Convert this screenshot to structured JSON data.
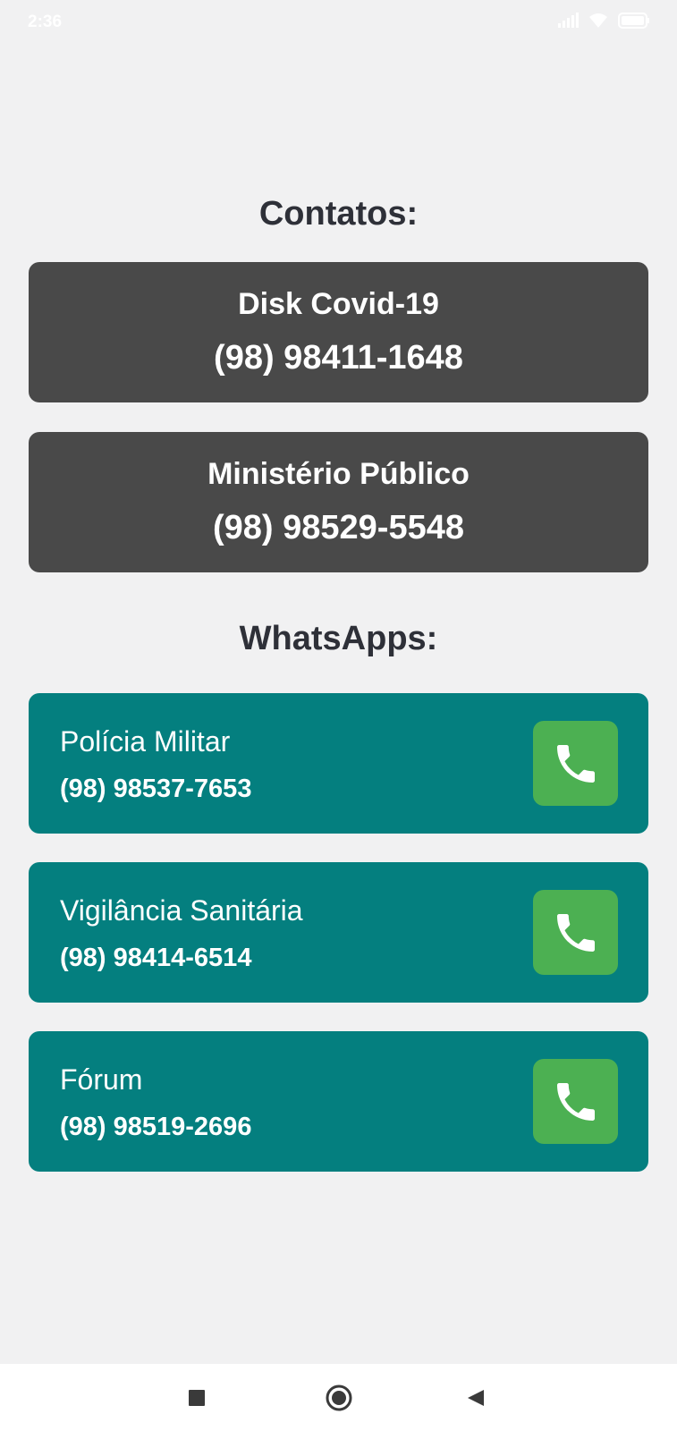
{
  "status_bar": {
    "time": "2:36",
    "icons": [
      "signal-icon",
      "wifi-icon",
      "battery-icon"
    ]
  },
  "contacts": {
    "title": "Contatos:",
    "items": [
      {
        "name": "Disk Covid-19",
        "phone": "(98) 98411-1648"
      },
      {
        "name": "Ministério Público",
        "phone": "(98) 98529-5548"
      }
    ]
  },
  "whatsapps": {
    "title": "WhatsApps:",
    "items": [
      {
        "name": "Polícia Militar",
        "phone": "(98) 98537-7653",
        "icon": "phone-icon"
      },
      {
        "name": "Vigilância Sanitária",
        "phone": "(98) 98414-6514",
        "icon": "phone-icon"
      },
      {
        "name": "Fórum",
        "phone": "(98) 98519-2696",
        "icon": "phone-icon"
      }
    ]
  },
  "nav_bar": {
    "buttons": [
      "recent-apps-icon",
      "home-icon",
      "back-icon"
    ]
  },
  "colors": {
    "background": "#f1f1f2",
    "dark_card": "#494949",
    "teal_card": "#047f7f",
    "call_button": "#4cb052",
    "title_text": "#2e3038"
  }
}
